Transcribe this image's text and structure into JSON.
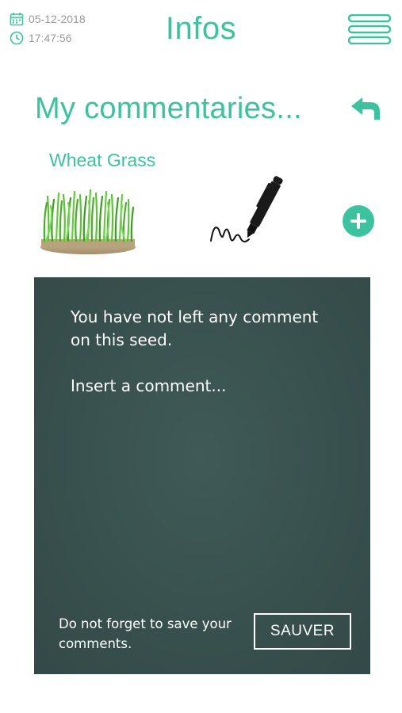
{
  "header": {
    "date": "05-12-2018",
    "time": "17:47:56",
    "title": "Infos",
    "menu_icon": "hamburger-menu-icon"
  },
  "subheader": {
    "title": "My commentaries...",
    "back_icon": "back-arrow-icon"
  },
  "seed": {
    "name": "Wheat Grass",
    "image": "wheat-grass-image",
    "pen_icon": "pen-signature-icon",
    "add_icon": "plus-circle-icon"
  },
  "board": {
    "message": "You have not left any comment on this seed.",
    "prompt": "Insert a comment...",
    "reminder": "Do not forget to save your comments.",
    "save_label": "SAUVER"
  },
  "colors": {
    "accent": "#3cc29f",
    "board": "#38504d",
    "muted": "#9a9a9a"
  }
}
